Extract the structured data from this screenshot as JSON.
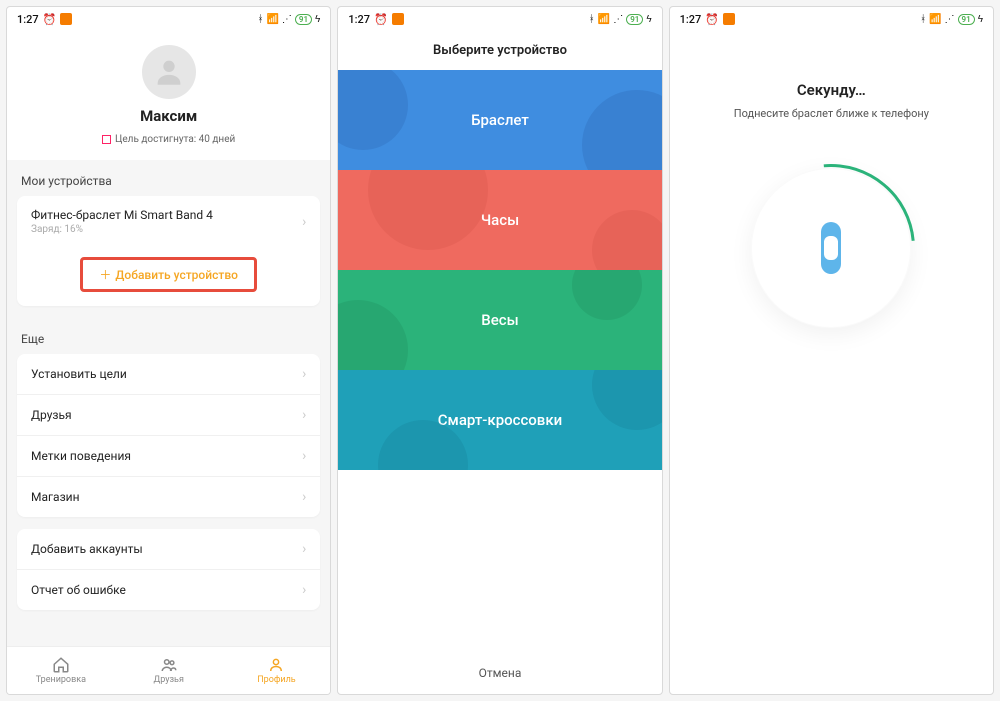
{
  "status": {
    "time": "1:27",
    "battery": "91"
  },
  "screen1": {
    "username": "Максим",
    "goal_text": "Цель достигнута: 40 дней",
    "section_devices": "Мои устройства",
    "device_name": "Фитнес-браслет Mi Smart Band 4",
    "device_charge": "Заряд: 16%",
    "add_device": "Добавить устройство",
    "section_more": "Еще",
    "more": {
      "goals": "Установить цели",
      "friends": "Друзья",
      "tags": "Метки поведения",
      "store": "Магазин",
      "add_accounts": "Добавить аккаунты",
      "bug": "Отчет об ошибке"
    },
    "nav": {
      "workout": "Тренировка",
      "friends": "Друзья",
      "profile": "Профиль"
    }
  },
  "screen2": {
    "title": "Выберите устройство",
    "tiles": {
      "bracelet": "Браслет",
      "watch": "Часы",
      "scale": "Весы",
      "sneakers": "Смарт-кроссовки"
    },
    "cancel": "Отмена"
  },
  "screen3": {
    "title": "Секунду…",
    "subtitle": "Поднесите браслет ближе к телефону"
  }
}
